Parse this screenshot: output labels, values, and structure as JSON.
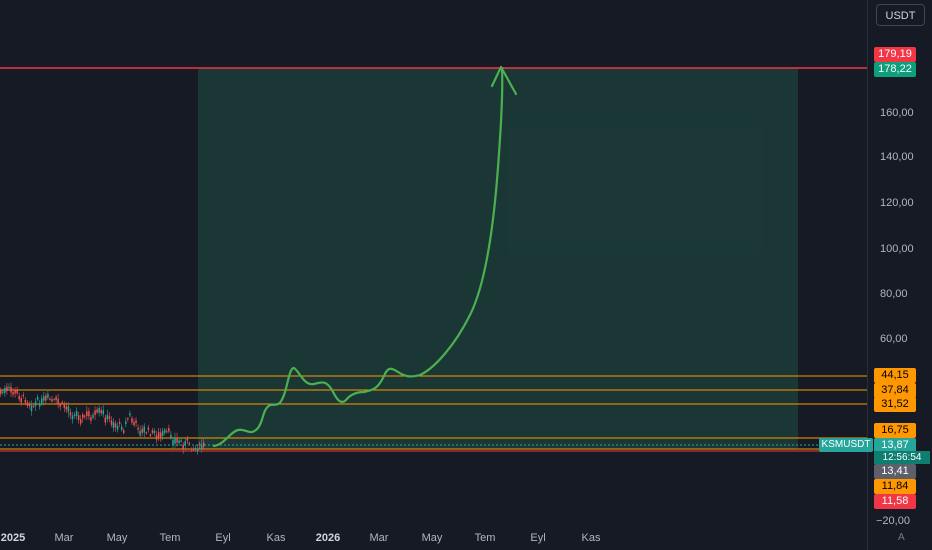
{
  "currency": "USDT",
  "symbol": "KSMUSDT",
  "countdown": "12:56:54",
  "auto_label": "A",
  "colors": {
    "background": "#161a25",
    "zone_fill": "#1f5146",
    "target_line": "#f23645",
    "level_line": "#ff9800",
    "arrow": "#4caf50",
    "candle_up": "#26a69a",
    "candle_down": "#ef5350"
  },
  "price_ticks": [
    "160,00",
    "140,00",
    "120,00",
    "100,00",
    "80,00",
    "60,00",
    "−20,00"
  ],
  "price_badges": [
    {
      "text": "179,19",
      "bg": "#f23645"
    },
    {
      "text": "178,22",
      "bg": "#0d9e7a"
    },
    {
      "text": "44,15",
      "bg": "#ff9800"
    },
    {
      "text": "37,84",
      "bg": "#ff9800"
    },
    {
      "text": "31,52",
      "bg": "#ff9800"
    },
    {
      "text": "16,75",
      "bg": "#ff9800"
    },
    {
      "text": "13,87",
      "bg": "#26a69a"
    },
    {
      "text": "13,41",
      "bg": "#5d606b"
    },
    {
      "text": "11,84",
      "bg": "#ff9800"
    },
    {
      "text": "11,58",
      "bg": "#f23645"
    }
  ],
  "time_labels": [
    {
      "text": "2025",
      "bold": true
    },
    {
      "text": "Mar",
      "bold": false
    },
    {
      "text": "May",
      "bold": false
    },
    {
      "text": "Tem",
      "bold": false
    },
    {
      "text": "Eyl",
      "bold": false
    },
    {
      "text": "Kas",
      "bold": false
    },
    {
      "text": "2026",
      "bold": true
    },
    {
      "text": "Mar",
      "bold": false
    },
    {
      "text": "May",
      "bold": false
    },
    {
      "text": "Tem",
      "bold": false
    },
    {
      "text": "Eyl",
      "bold": false
    },
    {
      "text": "Kas",
      "bold": false
    }
  ],
  "levels": {
    "target": 179.19,
    "zone_top": 178.22,
    "horizontal": [
      44.15,
      37.84,
      31.52,
      16.75,
      11.84,
      11.58
    ]
  }
}
